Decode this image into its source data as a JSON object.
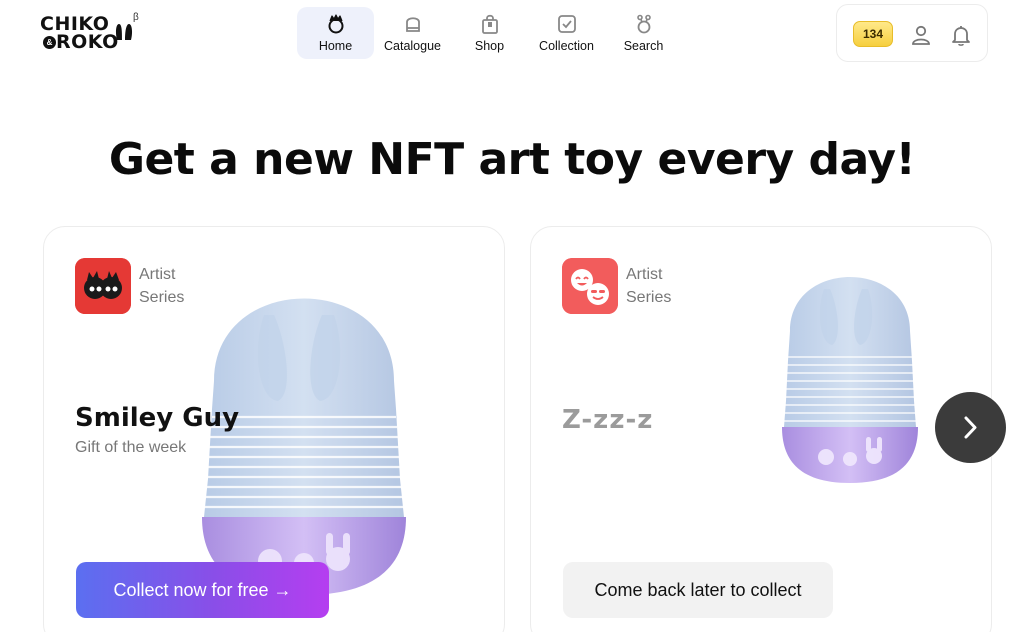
{
  "brand": {
    "line1": "CHIKO",
    "line2": "ROKO",
    "amp": "&",
    "beta": "β"
  },
  "nav": {
    "items": [
      {
        "label": "Home",
        "icon": "home-icon",
        "active": true
      },
      {
        "label": "Catalogue",
        "icon": "catalogue-icon",
        "active": false
      },
      {
        "label": "Shop",
        "icon": "shop-bag-icon",
        "active": false
      },
      {
        "label": "Collection",
        "icon": "collection-check-icon",
        "active": false
      },
      {
        "label": "Search",
        "icon": "search-icon",
        "active": false
      }
    ]
  },
  "user": {
    "coins": "134",
    "icons": [
      "user-icon",
      "bell-icon"
    ]
  },
  "hero": {
    "title": "Get a new NFT art toy every day!"
  },
  "cards": [
    {
      "series_line1": "Artist",
      "series_line2": "Series",
      "name": "Smiley Guy",
      "subtitle": "Gift of the week",
      "button_label": "Collect now for free →"
    },
    {
      "series_line1": "Artist",
      "series_line2": "Series",
      "status": "Z-zz-z",
      "button_label": "Come back later to collect"
    }
  ],
  "colors": {
    "accent_gradient_start": "#5b6ff0",
    "accent_gradient_end": "#b53ef0",
    "coin_badge": "#f6cf3f",
    "toy_top": "#c9d9ee",
    "toy_base": "#c3a7ea",
    "next_button": "#3b3b3b"
  }
}
